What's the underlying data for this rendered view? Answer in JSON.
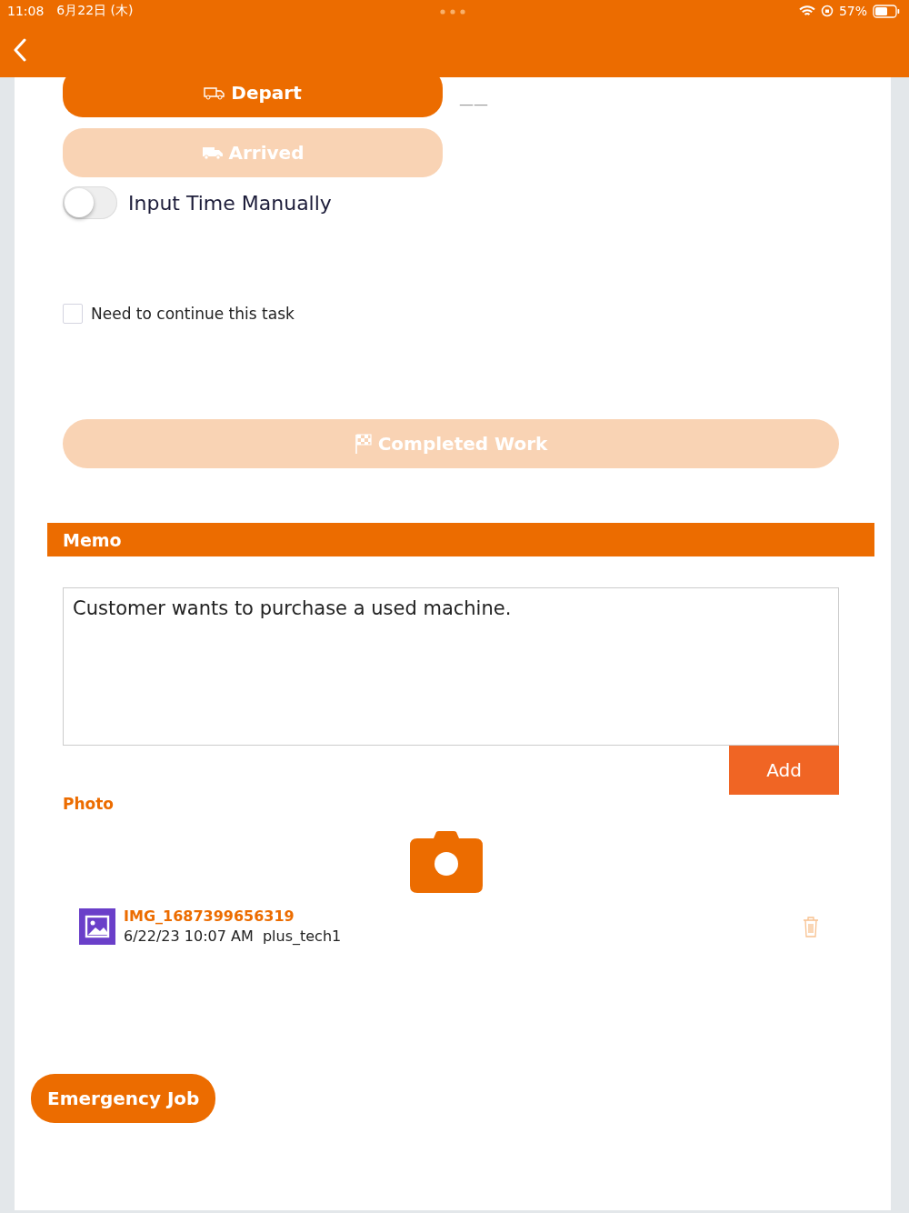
{
  "status_bar": {
    "time": "11:08",
    "date": "6月22日 (木)",
    "battery": "57%"
  },
  "trip_buttons": [
    {
      "label": "Depart",
      "disabled": false
    },
    {
      "label": "Arrived",
      "disabled": true
    }
  ],
  "side_note": "——",
  "manual_time": {
    "label": "Input Time Manually",
    "on": false
  },
  "continue_task": {
    "label": "Need to continue this task",
    "checked": false
  },
  "complete_button": {
    "label": "Completed Work",
    "disabled": true
  },
  "memo": {
    "title": "Memo",
    "value": "Customer wants to purchase a used machine.",
    "add_button": "Add"
  },
  "photo": {
    "title": "Photo",
    "files": [
      {
        "name": "IMG_1687399656319",
        "meta": "6/22/23 10:07 AM  plus_tech1"
      }
    ]
  },
  "emergency_button": "Emergency Job"
}
